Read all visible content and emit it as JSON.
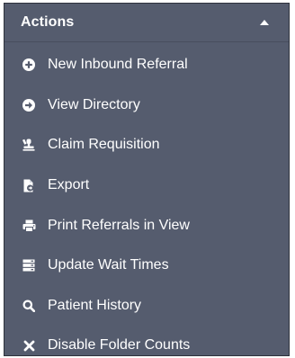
{
  "panel": {
    "title": "Actions",
    "toggle_icon": "caret-up-icon"
  },
  "actions": [
    {
      "label": "New Inbound Referral",
      "icon": "plus-circle-icon"
    },
    {
      "label": "View Directory",
      "icon": "arrow-circle-right-icon"
    },
    {
      "label": "Claim Requisition",
      "icon": "claim-stamp-icon"
    },
    {
      "label": "Export",
      "icon": "file-export-icon"
    },
    {
      "label": "Print Referrals in View",
      "icon": "print-icon"
    },
    {
      "label": "Update Wait Times",
      "icon": "server-list-icon"
    },
    {
      "label": "Patient History",
      "icon": "search-icon"
    },
    {
      "label": "Disable Folder Counts",
      "icon": "close-icon"
    }
  ],
  "colors": {
    "panel_background": "#555c6e",
    "text": "#ffffff",
    "border": "#2e323c"
  }
}
